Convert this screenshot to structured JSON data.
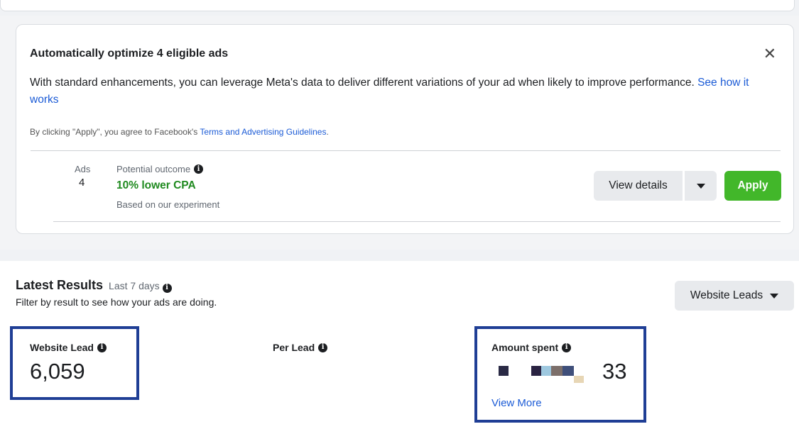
{
  "optimize_card": {
    "title": "Automatically optimize 4 eligible ads",
    "description": "With standard enhancements, you can leverage Meta's data to deliver different variations of your ad when likely to improve performance.",
    "see_link": "See how it works",
    "legal_prefix": "By clicking \"Apply\", you agree to Facebook's ",
    "legal_link": "Terms and Advertising Guidelines",
    "legal_suffix": ".",
    "ads_label": "Ads",
    "ads_count": "4",
    "outcome_label": "Potential outcome",
    "outcome_value": "10% lower CPA",
    "outcome_basis": "Based on our experiment",
    "view_details": "View details",
    "apply": "Apply"
  },
  "results": {
    "title": "Latest Results",
    "range": "Last 7 days",
    "subtitle": "Filter by result to see how your ads are doing.",
    "filter_selected": "Website Leads",
    "metrics": {
      "website_lead": {
        "label": "Website Lead",
        "value": "6,059"
      },
      "per_lead": {
        "label": "Per Lead"
      },
      "amount_spent": {
        "label": "Amount spent",
        "visible_suffix": "33",
        "view_more": "View More"
      }
    }
  },
  "colors": {
    "accent_link": "#1b5bd6",
    "apply_green": "#42b72a",
    "outcome_green": "#1f8a1f",
    "highlight_border": "#1f3e95"
  },
  "icons": [
    "close-icon",
    "info-icon",
    "caret-down-icon"
  ]
}
